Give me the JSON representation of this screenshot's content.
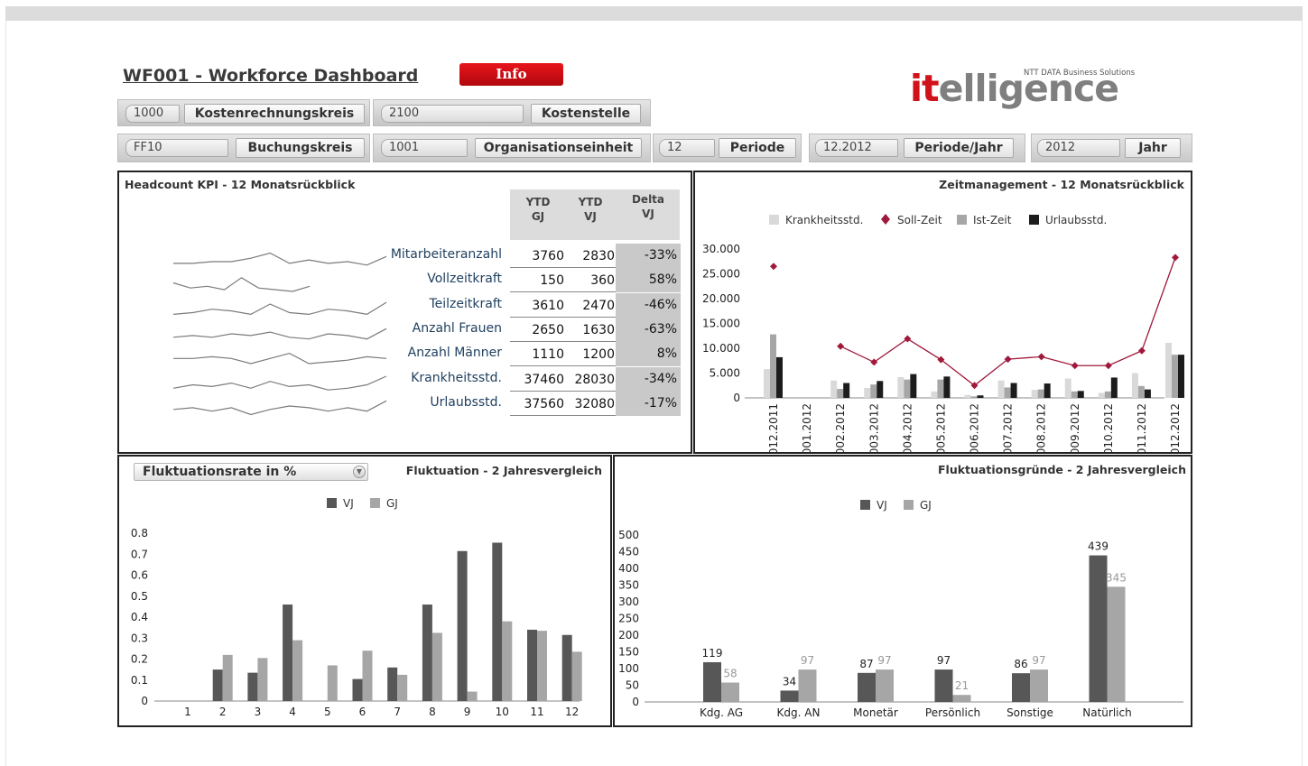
{
  "header": {
    "title": "WF001 - Workforce Dashboard",
    "info_label": "Info",
    "logo_it": "it",
    "logo_rest": "elligence",
    "logo_sub": "NTT DATA Business Solutions"
  },
  "filters": {
    "kokrs_value": "1000",
    "kokrs_label": "Kostenrechnungskreis",
    "kostl_value": "2100",
    "kostl_label": "Kostenstelle",
    "bukrs_value": "FF10",
    "bukrs_label": "Buchungskreis",
    "orgeh_value": "1001",
    "orgeh_label": "Organisationseinheit",
    "periode_value": "12",
    "periode_label": "Periode",
    "periodejahr_value": "12.2012",
    "periodejahr_label": "Periode/Jahr",
    "jahr_value": "2012",
    "jahr_label": "Jahr"
  },
  "kpi": {
    "title": "Headcount KPI  - 12 Monatsrückblick",
    "col_ytd_gj": "YTD\nGJ",
    "col_ytd_vj": "YTD\nVJ",
    "col_delta": "Delta\nVJ",
    "rows": [
      {
        "label": "Mitarbeiteranzahl",
        "gj": "3760",
        "vj": "2830",
        "delta": "-33%"
      },
      {
        "label": "Vollzeitkraft",
        "gj": "150",
        "vj": "360",
        "delta": "58%"
      },
      {
        "label": "Teilzeitkraft",
        "gj": "3610",
        "vj": "2470",
        "delta": "-46%"
      },
      {
        "label": "Anzahl Frauen",
        "gj": "2650",
        "vj": "1630",
        "delta": "-63%"
      },
      {
        "label": "Anzahl Männer",
        "gj": "1110",
        "vj": "1200",
        "delta": "8%"
      },
      {
        "label": "Krankheitsstd.",
        "gj": "37460",
        "vj": "28030",
        "delta": "-34%"
      },
      {
        "label": "Urlaubsstd.",
        "gj": "37560",
        "vj": "32080",
        "delta": "-17%"
      }
    ]
  },
  "fluct_dropdown": "Fluktuationsrate in %",
  "colors": {
    "dark": "#575757",
    "light": "#a6a6a6",
    "vlight": "#d9d9d9",
    "black": "#1c1c1c",
    "soll": "#a0183a"
  },
  "chart_data": [
    {
      "type": "line",
      "title": "Headcount KPI  - 12 Monatsrückblick",
      "note": "sparklines, one per KPI row, 10 months, shape only",
      "series": [
        {
          "name": "Mitarbeiteranzahl",
          "values": [
            4,
            4,
            5,
            5,
            7,
            10,
            4,
            6,
            4,
            5,
            3,
            8
          ]
        },
        {
          "name": "Vollzeitkraft",
          "values": [
            7,
            4,
            5,
            3,
            10,
            4,
            3,
            2,
            5
          ]
        },
        {
          "name": "Teilzeitkraft",
          "values": [
            3,
            4,
            6,
            5,
            3,
            9,
            4,
            3,
            6,
            5,
            3,
            10
          ]
        },
        {
          "name": "Anzahl Frauen",
          "values": [
            4,
            5,
            4,
            6,
            5,
            7,
            4,
            3,
            6,
            5,
            3,
            9
          ]
        },
        {
          "name": "Anzahl Männer",
          "values": [
            6,
            6,
            7,
            6,
            3,
            6,
            9,
            3,
            4,
            5,
            7,
            6
          ]
        },
        {
          "name": "Krankheitsstd.",
          "values": [
            3,
            5,
            4,
            6,
            3,
            7,
            4,
            5,
            2,
            3,
            5,
            10
          ]
        },
        {
          "name": "Urlaubsstd.",
          "values": [
            5,
            6,
            4,
            6,
            2,
            5,
            7,
            6,
            4,
            6,
            4,
            10
          ]
        }
      ]
    },
    {
      "type": "bar",
      "title": "Zeitmanagement - 12 Monatsrückblick",
      "categories": [
        "012.2011",
        "001.2012",
        "002.2012",
        "003.2012",
        "004.2012",
        "005.2012",
        "006.2012",
        "007.2012",
        "008.2012",
        "009.2012",
        "010.2012",
        "011.2012",
        "012.2012"
      ],
      "ylim": [
        0,
        30000
      ],
      "yticks": [
        "0",
        "5.000",
        "10.000",
        "15.000",
        "20.000",
        "25.000",
        "30.000"
      ],
      "series": [
        {
          "name": "Krankheitsstd.",
          "kind": "bar",
          "values": [
            5800,
            0,
            3500,
            2000,
            4200,
            1300,
            600,
            3500,
            1600,
            3900,
            1000,
            5000,
            11100
          ]
        },
        {
          "name": "Ist-Zeit",
          "kind": "bar",
          "values": [
            12800,
            0,
            1800,
            2700,
            3700,
            3700,
            300,
            2100,
            1700,
            1300,
            1300,
            2400,
            8700
          ]
        },
        {
          "name": "Urlaubsstd.",
          "kind": "bar",
          "values": [
            8200,
            0,
            3000,
            3400,
            4800,
            4300,
            500,
            3000,
            2900,
            1400,
            4100,
            1700,
            8700
          ]
        },
        {
          "name": "Soll-Zeit",
          "kind": "line",
          "values": [
            26500,
            null,
            10400,
            7200,
            11900,
            7700,
            2500,
            7800,
            8300,
            6500,
            6500,
            9500,
            28300
          ]
        }
      ]
    },
    {
      "type": "bar",
      "title": "Fluktuation - 2 Jahresvergleich",
      "categories": [
        "1",
        "2",
        "3",
        "4",
        "5",
        "6",
        "7",
        "8",
        "9",
        "10",
        "11",
        "12"
      ],
      "ylim": [
        0,
        0.8
      ],
      "yticks": [
        "0",
        "0.1",
        "0.2",
        "0.3",
        "0.4",
        "0.5",
        "0.6",
        "0.7",
        "0.8"
      ],
      "series": [
        {
          "name": "VJ",
          "values": [
            0,
            0.15,
            0.135,
            0.46,
            0,
            0.105,
            0.16,
            0.46,
            0.715,
            0.755,
            0.34,
            0.315
          ]
        },
        {
          "name": "GJ",
          "values": [
            0,
            0.22,
            0.205,
            0.29,
            0.17,
            0.24,
            0.125,
            0.325,
            0.045,
            0.38,
            0.335,
            0.235
          ]
        }
      ]
    },
    {
      "type": "bar",
      "title": "Fluktuationsgründe - 2 Jahresvergleich",
      "categories": [
        "Kdg. AG",
        "Kdg. AN",
        "Monetär",
        "Persönlich",
        "Sonstige",
        "Natürlich"
      ],
      "ylim": [
        0,
        500
      ],
      "yticks": [
        "0",
        "50",
        "100",
        "150",
        "200",
        "250",
        "300",
        "350",
        "400",
        "450",
        "500"
      ],
      "series": [
        {
          "name": "VJ",
          "values": [
            119,
            34,
            87,
            97,
            86,
            439
          ]
        },
        {
          "name": "GJ",
          "values": [
            58,
            97,
            97,
            21,
            97,
            345
          ]
        }
      ]
    }
  ]
}
